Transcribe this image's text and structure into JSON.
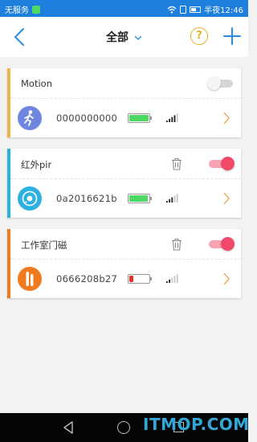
{
  "status_bar": {
    "carrier": "无服务",
    "time": "半夜12:46"
  },
  "header": {
    "title": "全部",
    "help_label": "?"
  },
  "devices": [
    {
      "name": "Motion",
      "accent_color": "#f0b24a",
      "icon": "motion-sensor-icon",
      "icon_color": "#6f86e0",
      "device_id": "0000000000",
      "battery_level": 1.0,
      "battery_color": "#4cd964",
      "enabled": false,
      "deletable": false,
      "signal_bars": 4
    },
    {
      "name": "红外pir",
      "accent_color": "#2eb0e0",
      "icon": "pir-sensor-icon",
      "icon_color": "#2eb0e0",
      "device_id": "0a2016621b",
      "battery_level": 0.95,
      "battery_color": "#4cd964",
      "enabled": true,
      "deletable": true,
      "signal_bars": 3
    },
    {
      "name": "工作室门磁",
      "accent_color": "#f07a1e",
      "icon": "door-sensor-icon",
      "icon_color": "#f07a1e",
      "device_id": "0666208b27",
      "battery_level": 0.2,
      "battery_color": "#e8322e",
      "enabled": true,
      "deletable": true,
      "signal_bars": 2
    }
  ],
  "watermark": "ITMOP.COM"
}
